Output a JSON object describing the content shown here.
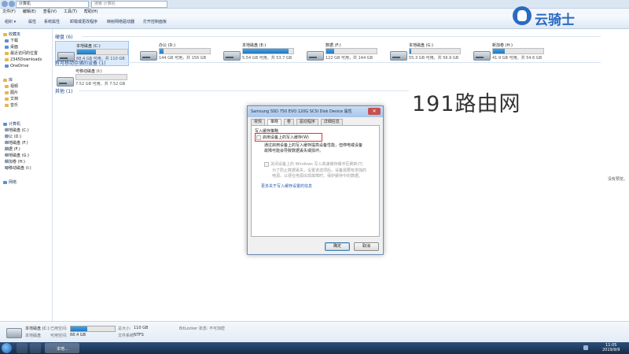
{
  "window": {
    "address": "计算机",
    "search_placeholder": "搜索 计算机",
    "menu": [
      "文件(F)",
      "编辑(E)",
      "查看(V)",
      "工具(T)",
      "帮助(H)"
    ],
    "toolbar": [
      "组织 ▾",
      "属性",
      "系统属性",
      "卸载或更改程序",
      "映射网络驱动器",
      "打开控制面板"
    ]
  },
  "sidebar": {
    "favorites_title": "收藏夹",
    "favorites": [
      "下载",
      "桌面",
      "最近访问的位置",
      "2345Downloads",
      "OneDrive"
    ],
    "library_title": "库",
    "libraries": [
      "视频",
      "图片",
      "文档",
      "音乐"
    ],
    "computer_title": "计算机",
    "drives": [
      "本地磁盘 (C:)",
      "办公 (D:)",
      "本地磁盘 (F:)",
      "数据 (F:)",
      "本地磁盘 (G:)",
      "新加卷 (H:)",
      "可移动磁盘 (I:)"
    ],
    "network": "网络"
  },
  "main": {
    "hdd_group": "硬盘 (6)",
    "removable_group": "有可移动存储的设备 (1)",
    "other_group": "其他 (1)",
    "drives": [
      {
        "name": "本地磁盘 (C:)",
        "info": "68.4 GB 可用，共 110 GB",
        "used_fraction": 0.38
      },
      {
        "name": "办公 (D:)",
        "info": "144 GB 可用，共 156 GB",
        "used_fraction": 0.08
      },
      {
        "name": "本地磁盘 (E:)",
        "info": "5.54 GB 可用，共 53.7 GB",
        "used_fraction": 0.9
      },
      {
        "name": "数据 (F:)",
        "info": "122 GB 可用，共 144 GB",
        "used_fraction": 0.15
      },
      {
        "name": "本地磁盘 (G:)",
        "info": "55.3 GB 可用，共 56.9 GB",
        "used_fraction": 0.03
      },
      {
        "name": "新加卷 (H:)",
        "info": "41.9 GB 可用，共 54.6 GB",
        "used_fraction": 0.23
      }
    ],
    "removable": {
      "name": "可移动磁盘 (I:)",
      "info": "7.52 GB 可用，共 7.52 GB",
      "used_fraction": 0.0
    }
  },
  "watermark": {
    "logo_text": "云骑士",
    "site_text": "191路由网"
  },
  "dialog": {
    "title": "Samsung SSD 750 EVO 120G SCSI Disk Device 属性",
    "tabs": [
      "常规",
      "策略",
      "卷",
      "驱动程序",
      "详细信息"
    ],
    "section_title": "写入缓存策略",
    "option1": "启用设备上的写入缓存(W)",
    "option1_desc_1": "通过启用设备上的写入缓存提高设备性能，但停电或设备",
    "option1_desc_2": "故障可能会导致数据丢失或损坏。",
    "option2": "关闭设备上的 Windows 写入高速缓存缓冲区刷新(T)",
    "option2_desc_1": "为了防止数据丢失，设置该选项后，设备需要有单独的",
    "option2_desc_2": "电源，以便在电源出现故障时，保护缓存中的数据。",
    "link": "更多关于写入缓存设置的信息",
    "ok": "确定",
    "cancel": "取消"
  },
  "right_note": "没有预览。",
  "details": {
    "drive_name": "本地磁盘 (C:)",
    "drive_type": "本地磁盘",
    "used_label": "已用空间:",
    "free_label": "可用空间:",
    "free_value": "68.4 GB",
    "total_label": "总大小:",
    "total_value": "110 GB",
    "fs_label": "文件系统:",
    "fs_value": "NTFS",
    "bitlocker": "BitLocker 状态: 不可加密",
    "used_fraction": 0.38
  },
  "taskbar": {
    "task_label": "本地...",
    "time": "11:05",
    "date": "2019/9/9"
  },
  "colors": {
    "accent": "#1f77c2",
    "link": "#1f58b8",
    "highlight_box": "#d33b30"
  }
}
